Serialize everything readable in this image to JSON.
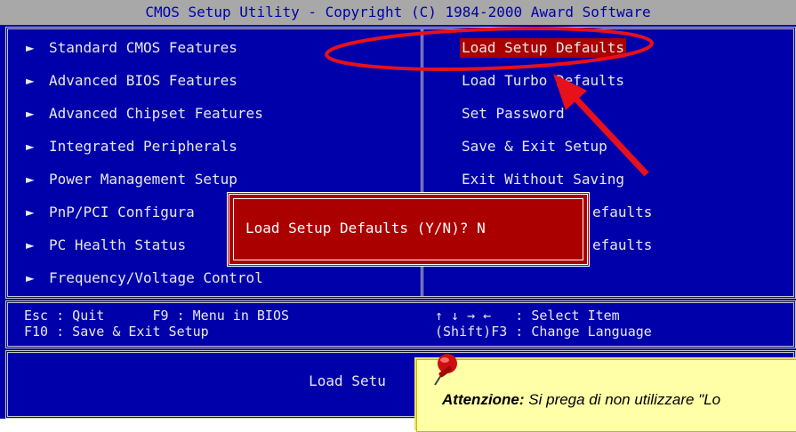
{
  "title": "CMOS Setup Utility - Copyright (C) 1984-2000 Award Software",
  "left_menu": [
    {
      "label": "Standard CMOS Features"
    },
    {
      "label": "Advanced BIOS Features"
    },
    {
      "label": "Advanced Chipset Features"
    },
    {
      "label": "Integrated Peripherals"
    },
    {
      "label": "Power Management Setup"
    },
    {
      "label": "PnP/PCI Configura"
    },
    {
      "label": "PC Health Status"
    },
    {
      "label": "Frequency/Voltage Control"
    }
  ],
  "right_menu": [
    {
      "label": "Load Setup Defaults"
    },
    {
      "label": "Load Turbo Defaults"
    },
    {
      "label": "Set Password"
    },
    {
      "label": "Save & Exit Setup"
    },
    {
      "label": "Exit Without Saving"
    },
    {
      "label": "efaults"
    },
    {
      "label": "efaults"
    }
  ],
  "menu_arrow": "►",
  "help": {
    "esc": "Esc : Quit      F9 : Menu in BIOS",
    "f10": "F10 : Save & Exit Setup",
    "select": "↑ ↓ → ←   : Select Item",
    "lang": "(Shift)F3 : Change Language"
  },
  "status": "Load Setu",
  "dialog": {
    "prompt": "Load Setup Defaults (Y/N)? N"
  },
  "note": {
    "heading": "Attenzione:",
    "text": " Si prega di non utilizzare \"Lo"
  },
  "colors": {
    "bios_blue": "#0000aa",
    "highlight_red": "#aa0000",
    "annotation_red": "#e8101a",
    "note_yellow": "#ffffa8"
  },
  "icons": [
    "pushpin-icon",
    "red-arrow-annotation",
    "red-ellipse-annotation"
  ]
}
